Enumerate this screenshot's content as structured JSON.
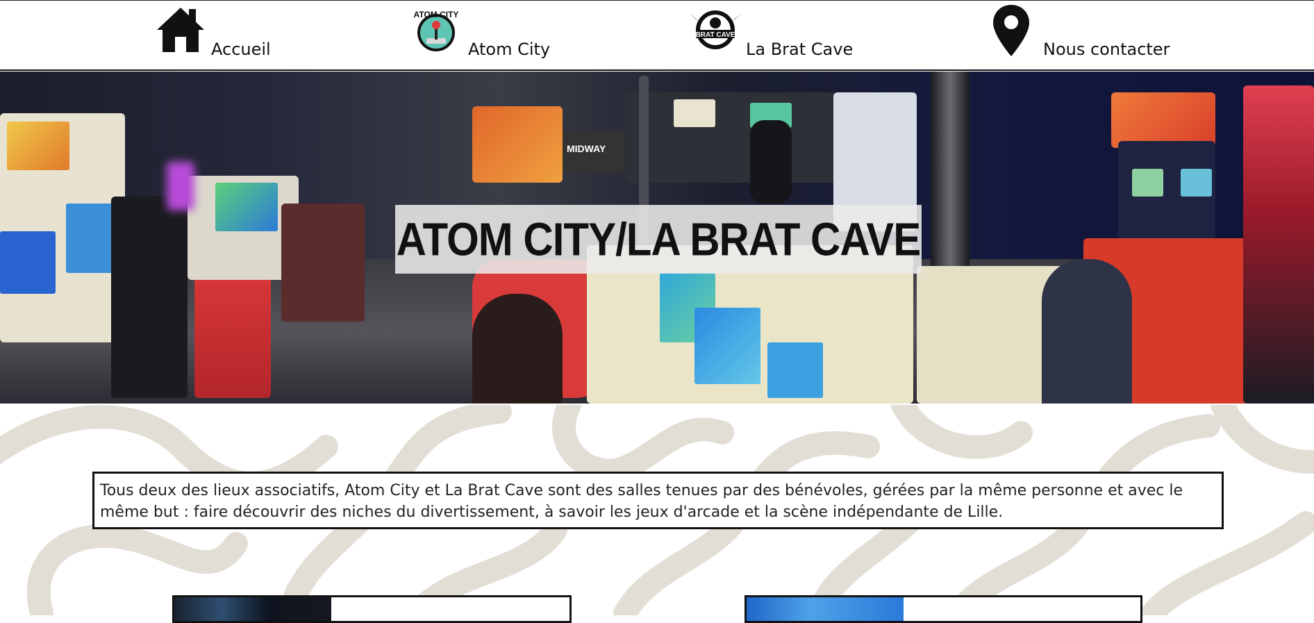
{
  "nav": {
    "items": [
      {
        "label": "Accueil",
        "icon": "home-icon"
      },
      {
        "label": "Atom City",
        "icon": "atom-city-logo"
      },
      {
        "label": "La Brat Cave",
        "icon": "brat-cave-logo"
      },
      {
        "label": "Nous contacter",
        "icon": "map-pin-icon"
      }
    ],
    "atom_logo_text": "ATOM CITY",
    "brat_logo_text": "BRAT CAVE"
  },
  "hero": {
    "title": "ATOM CITY/LA BRAT CAVE",
    "signage": "MIDWAY"
  },
  "intro": {
    "text": "Tous deux des lieux associatifs, Atom City et La Brat Cave sont des salles tenues par des bénévoles, gérées par la même personne et avec le même but : faire découvrir des niches du divertissement, à savoir les jeux d'arcade et la scène indépendante de Lille."
  },
  "colors": {
    "swirl": "#e2ded6",
    "atom_teal": "#5ec4b4",
    "text": "#111111"
  }
}
